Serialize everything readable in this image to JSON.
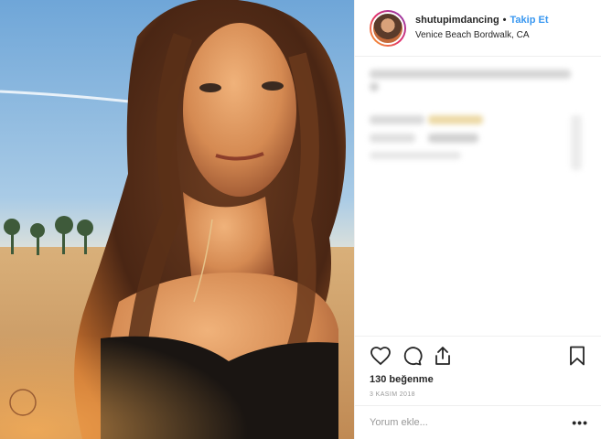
{
  "post": {
    "username": "shutupimdancing",
    "separator": "•",
    "follow_label": "Takip Et",
    "location": "Venice Beach Bordwalk, CA",
    "likes": "130 beğenme",
    "date": "3 KASIM 2018",
    "comment_placeholder": "Yorum ekle...",
    "more_label": "•••"
  },
  "icons": {
    "like": "heart-icon",
    "comment": "comment-icon",
    "share": "share-icon",
    "save": "bookmark-icon"
  },
  "colors": {
    "link": "#3897f0",
    "text": "#262626",
    "muted": "#999999",
    "divider": "#efefef"
  }
}
